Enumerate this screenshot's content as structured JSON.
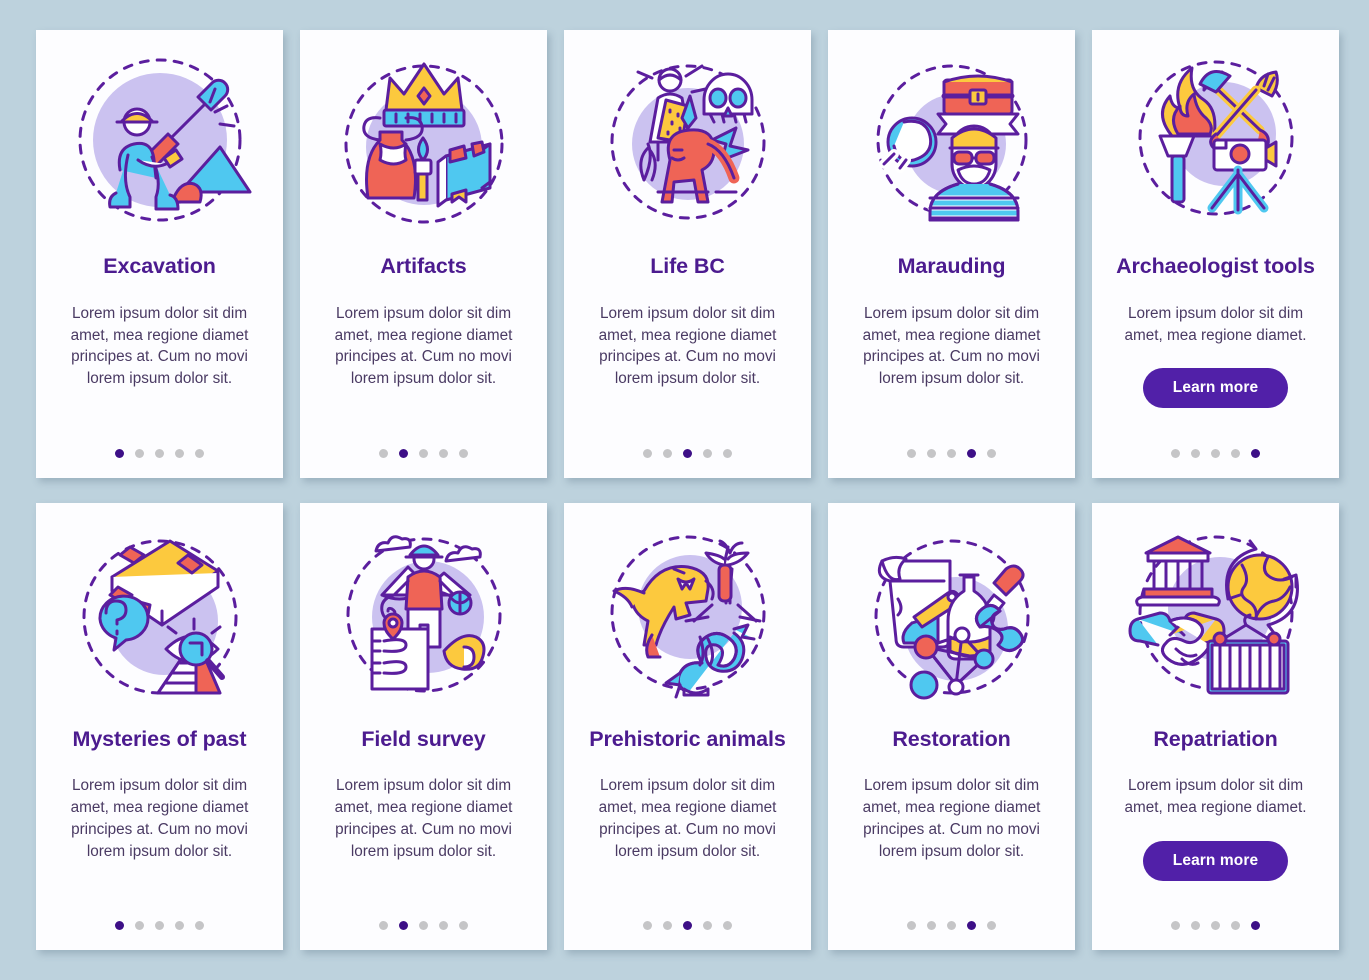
{
  "theme": {
    "background": "#bdd2dd",
    "card_background": "#fdfdff",
    "title_color": "#4c1b8f",
    "body_color": "#4a3a63",
    "accent_color": "#5120a8",
    "dot_active_color": "#3d0f87",
    "dot_inactive_color": "#c5c5c7",
    "illustration_blob": "#cbc2f0",
    "illustration_outline": "#5b1e9e",
    "illustration_red": "#ef6456",
    "illustration_yellow": "#fcc93e",
    "illustration_cyan": "#4fc8f0",
    "illustration_blue": "#3ab7ef"
  },
  "common": {
    "description_long": "Lorem ipsum dolor sit dim amet, mea regione diamet principes at. Cum no movi lorem ipsum dolor sit.",
    "description_short": "Lorem ipsum dolor sit dim amet, mea regione diamet.",
    "learn_more_label": "Learn more",
    "dot_count": 5
  },
  "rows": [
    {
      "cards": [
        {
          "id": "excavation",
          "title": "Excavation",
          "description": "Lorem ipsum dolor sit dim amet, mea regione diamet principes at. Cum no movi lorem ipsum dolor sit.",
          "has_button": false,
          "active_dot": 1,
          "icon": "excavation-illustration"
        },
        {
          "id": "artifacts",
          "title": "Artifacts",
          "description": "Lorem ipsum dolor sit dim amet, mea regione diamet principes at. Cum no movi lorem ipsum dolor sit.",
          "has_button": false,
          "active_dot": 2,
          "icon": "artifacts-illustration"
        },
        {
          "id": "life-bc",
          "title": "Life BC",
          "description": "Lorem ipsum dolor sit dim amet, mea regione diamet principes at. Cum no movi lorem ipsum dolor sit.",
          "has_button": false,
          "active_dot": 3,
          "icon": "life-bc-illustration"
        },
        {
          "id": "marauding",
          "title": "Marauding",
          "description": "Lorem ipsum dolor sit dim amet, mea regione diamet principes at. Cum no movi lorem ipsum dolor sit.",
          "has_button": false,
          "active_dot": 4,
          "icon": "marauding-illustration"
        },
        {
          "id": "archaeologist-tools",
          "title": "Archaeologist tools",
          "description": "Lorem ipsum dolor sit dim amet, mea regione diamet.",
          "has_button": true,
          "button_label": "Learn more",
          "active_dot": 5,
          "icon": "archaeologist-tools-illustration"
        }
      ]
    },
    {
      "cards": [
        {
          "id": "mysteries-of-past",
          "title": "Mysteries of past",
          "description": "Lorem ipsum dolor sit dim amet, mea regione diamet principes at. Cum no movi lorem ipsum dolor sit.",
          "has_button": false,
          "active_dot": 1,
          "icon": "mysteries-of-past-illustration"
        },
        {
          "id": "field-survey",
          "title": "Field survey",
          "description": "Lorem ipsum dolor sit dim amet, mea regione diamet principes at. Cum no movi lorem ipsum dolor sit.",
          "has_button": false,
          "active_dot": 2,
          "icon": "field-survey-illustration"
        },
        {
          "id": "prehistoric-animals",
          "title": "Prehistoric animals",
          "description": "Lorem ipsum dolor sit dim amet, mea regione diamet principes at. Cum no movi lorem ipsum dolor sit.",
          "has_button": false,
          "active_dot": 3,
          "icon": "prehistoric-animals-illustration"
        },
        {
          "id": "restoration",
          "title": "Restoration",
          "description": "Lorem ipsum dolor sit dim amet, mea regione diamet principes at. Cum no movi lorem ipsum dolor sit.",
          "has_button": false,
          "active_dot": 4,
          "icon": "restoration-illustration"
        },
        {
          "id": "repatriation",
          "title": "Repatriation",
          "description": "Lorem ipsum dolor sit dim amet, mea regione diamet.",
          "has_button": true,
          "button_label": "Learn more",
          "active_dot": 5,
          "icon": "repatriation-illustration"
        }
      ]
    }
  ]
}
